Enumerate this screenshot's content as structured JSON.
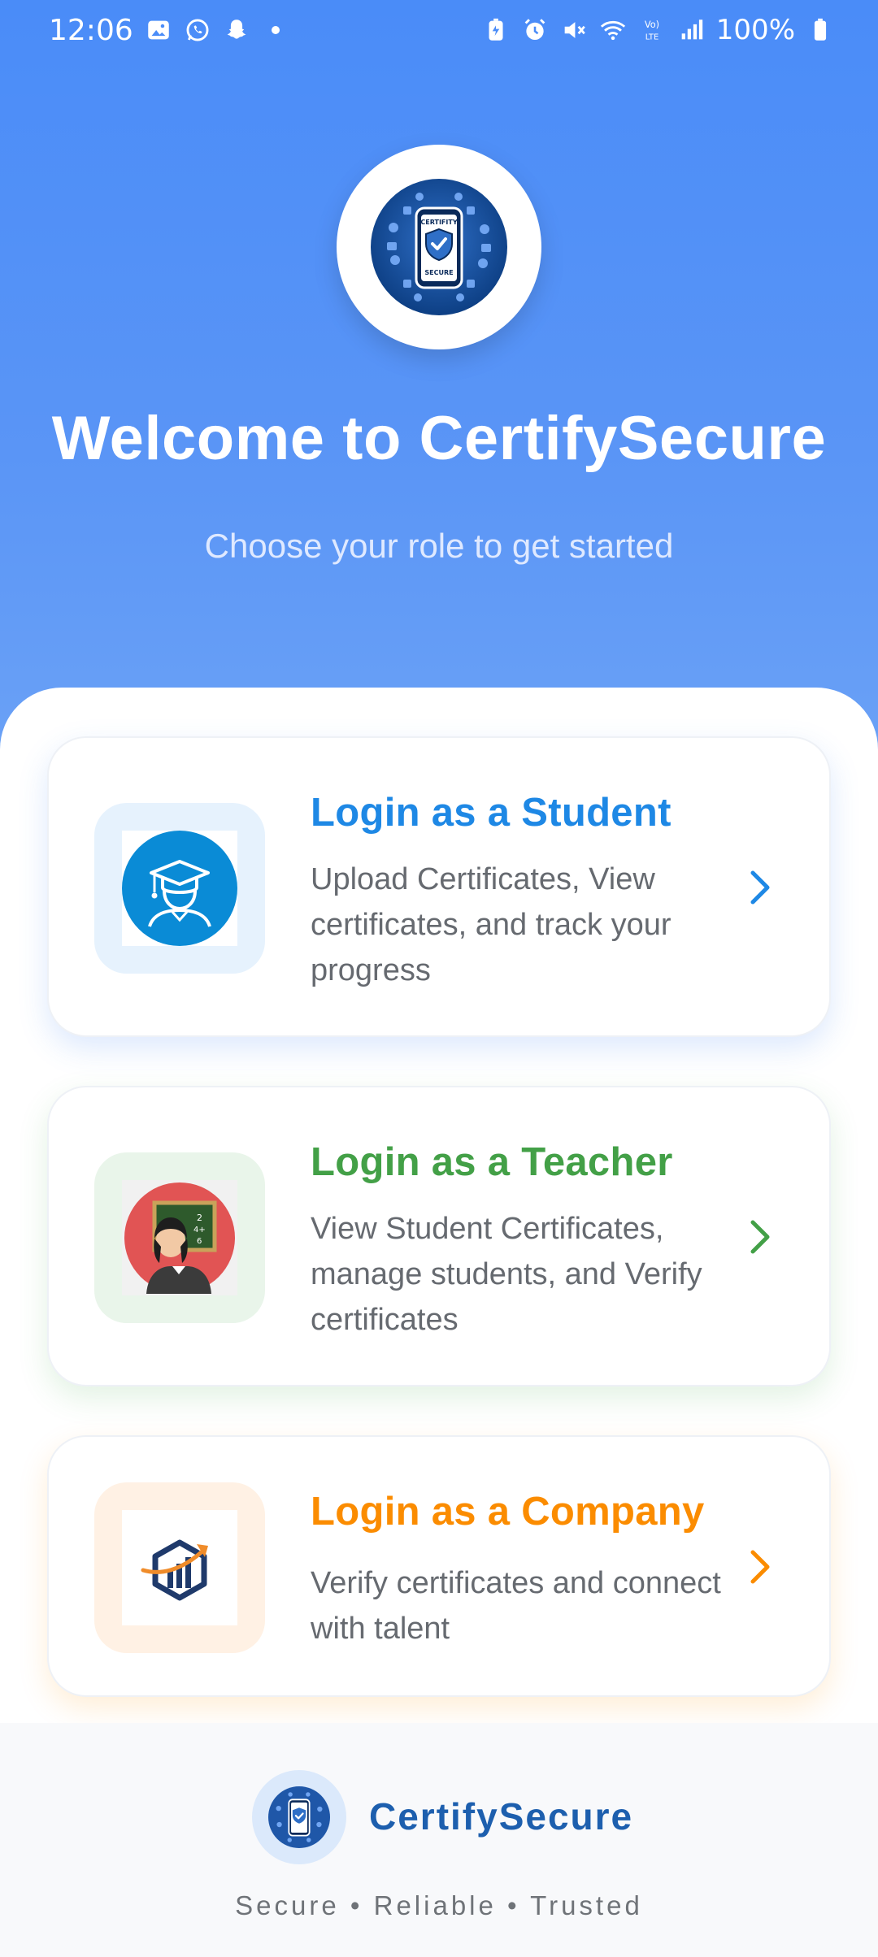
{
  "status_bar": {
    "time": "12:06",
    "battery": "100%",
    "left_icons": [
      "gallery-icon",
      "whatsapp-icon",
      "snapchat-icon",
      "notification-dot"
    ],
    "right_icons": [
      "battery-saver-icon",
      "alarm-icon",
      "mute-icon",
      "wifi-icon",
      "volte-icon",
      "signal-icon",
      "battery-icon"
    ]
  },
  "header": {
    "logo_text_top": "CERTIFITY",
    "logo_text_bottom": "SECURE",
    "title": "Welcome to CertifySecure",
    "subtitle": "Choose your role to get started",
    "background": "#4a8cf8"
  },
  "roles": [
    {
      "title": "Login as a Student",
      "description": "Upload Certificates, View certificates, and track your progress",
      "color": "#1e88e5",
      "icon": "student-graduate-icon"
    },
    {
      "title": "Login as a Teacher",
      "description": "View Student Certificates, manage students, and Verify certificates",
      "color": "#43a047",
      "icon": "teacher-chalkboard-icon"
    },
    {
      "title": "Login as a Company",
      "description": "Verify certificates and connect with talent",
      "color": "#fb8c00",
      "icon": "company-growth-icon"
    }
  ],
  "footer": {
    "brand": "CertifySecure",
    "tagline": "Secure • Reliable • Trusted",
    "brand_color": "#1d5fae"
  }
}
